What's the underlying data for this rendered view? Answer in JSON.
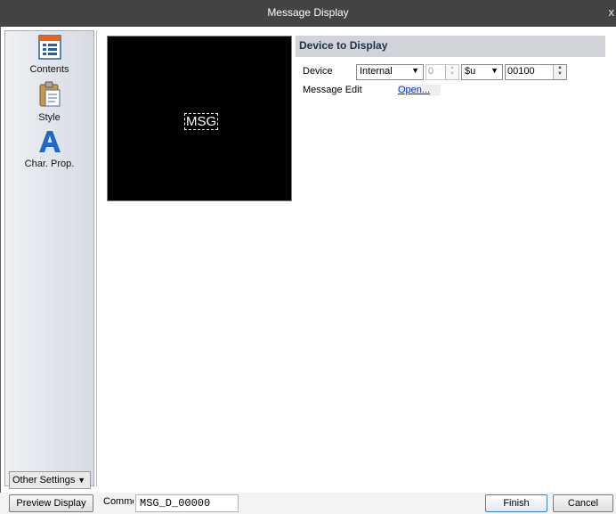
{
  "window": {
    "title": "Message Display",
    "close_glyph": "x"
  },
  "sidebar": {
    "items": [
      {
        "label": "Contents",
        "icon": "contents-icon"
      },
      {
        "label": "Style",
        "icon": "clipboard-icon"
      },
      {
        "label": "Char. Prop.",
        "icon": "letter-a-icon"
      }
    ],
    "other_settings_label": "Other Settings"
  },
  "preview": {
    "text": "MSG"
  },
  "section": {
    "title": "Device to Display"
  },
  "device": {
    "label": "Device",
    "type_value": "Internal",
    "index_value": "0",
    "register_value": "$u",
    "address_value": "00100"
  },
  "message_edit": {
    "label": "Message Edit",
    "link": "Open..."
  },
  "footer": {
    "preview_button": "Preview Display",
    "comment_label": "Comment",
    "comment_value": "MSG_D_00000",
    "finish_button": "Finish",
    "cancel_button": "Cancel"
  }
}
